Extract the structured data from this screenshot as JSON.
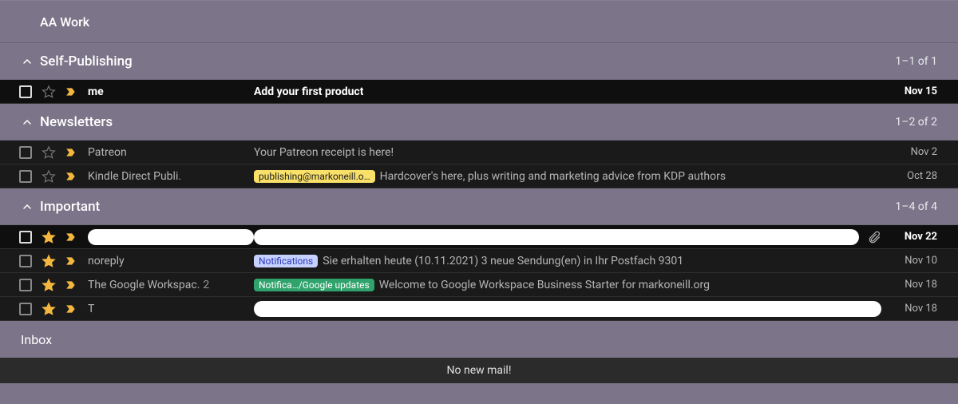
{
  "header": {
    "title": "AA Work"
  },
  "sections": [
    {
      "title": "Self-Publishing",
      "count": "1–1 of 1",
      "rows": [
        {
          "sender": "me",
          "sender_count": "",
          "subject": "Add your first product",
          "tags": [],
          "date": "Nov 15",
          "unread": true,
          "starred": false,
          "attachment": false
        }
      ]
    },
    {
      "title": "Newsletters",
      "count": "1–2 of 2",
      "rows": [
        {
          "sender": "Patreon",
          "sender_count": "",
          "subject": "Your Patreon receipt is here!",
          "tags": [],
          "date": "Nov 2",
          "unread": false,
          "starred": false,
          "attachment": false
        },
        {
          "sender": "Kindle Direct Publi.",
          "sender_count": "",
          "subject": "Hardcover's here, plus writing and marketing advice from KDP authors",
          "tags": [
            {
              "text": "publishing@markoneill.o…",
              "bg": "#f9e069",
              "fg": "#202124"
            }
          ],
          "date": "Oct 28",
          "unread": false,
          "starred": false,
          "attachment": false
        }
      ]
    },
    {
      "title": "Important",
      "count": "1–4 of 4",
      "rows": [
        {
          "sender": "",
          "sender_count": "",
          "subject": "",
          "tags": [],
          "date": "Nov 22",
          "unread": true,
          "starred": true,
          "attachment": true,
          "redacted_sender": true,
          "redacted_subject": true
        },
        {
          "sender": "noreply",
          "sender_count": "",
          "subject": "Sie erhalten heute (10.11.2021) 3 neue Sendung(en) in Ihr Postfach 9301",
          "tags": [
            {
              "text": "Notifications",
              "bg": "#c7d1ff",
              "fg": "#2d3bb8"
            }
          ],
          "date": "Nov 10",
          "unread": false,
          "starred": true,
          "attachment": false
        },
        {
          "sender": "The Google Workspac.",
          "sender_count": "2",
          "subject": "Welcome to Google Workspace Business Starter for markoneill.org",
          "tags": [
            {
              "text": "Notifica…/Google updates",
              "bg": "#2fa36b",
              "fg": "#ffffff"
            }
          ],
          "date": "Nov 18",
          "unread": false,
          "starred": true,
          "attachment": false
        },
        {
          "sender": "T",
          "sender_count": "",
          "subject": " ",
          "tags": [],
          "date": "Nov 18",
          "unread": false,
          "starred": true,
          "attachment": false,
          "redacted_subject": true
        }
      ]
    }
  ],
  "inbox": {
    "label": "Inbox",
    "empty_message": "No new mail!"
  },
  "colors": {
    "star_on": "#f4b73e",
    "star_off": "#7a7a7a",
    "marker": "#f4b73e"
  }
}
